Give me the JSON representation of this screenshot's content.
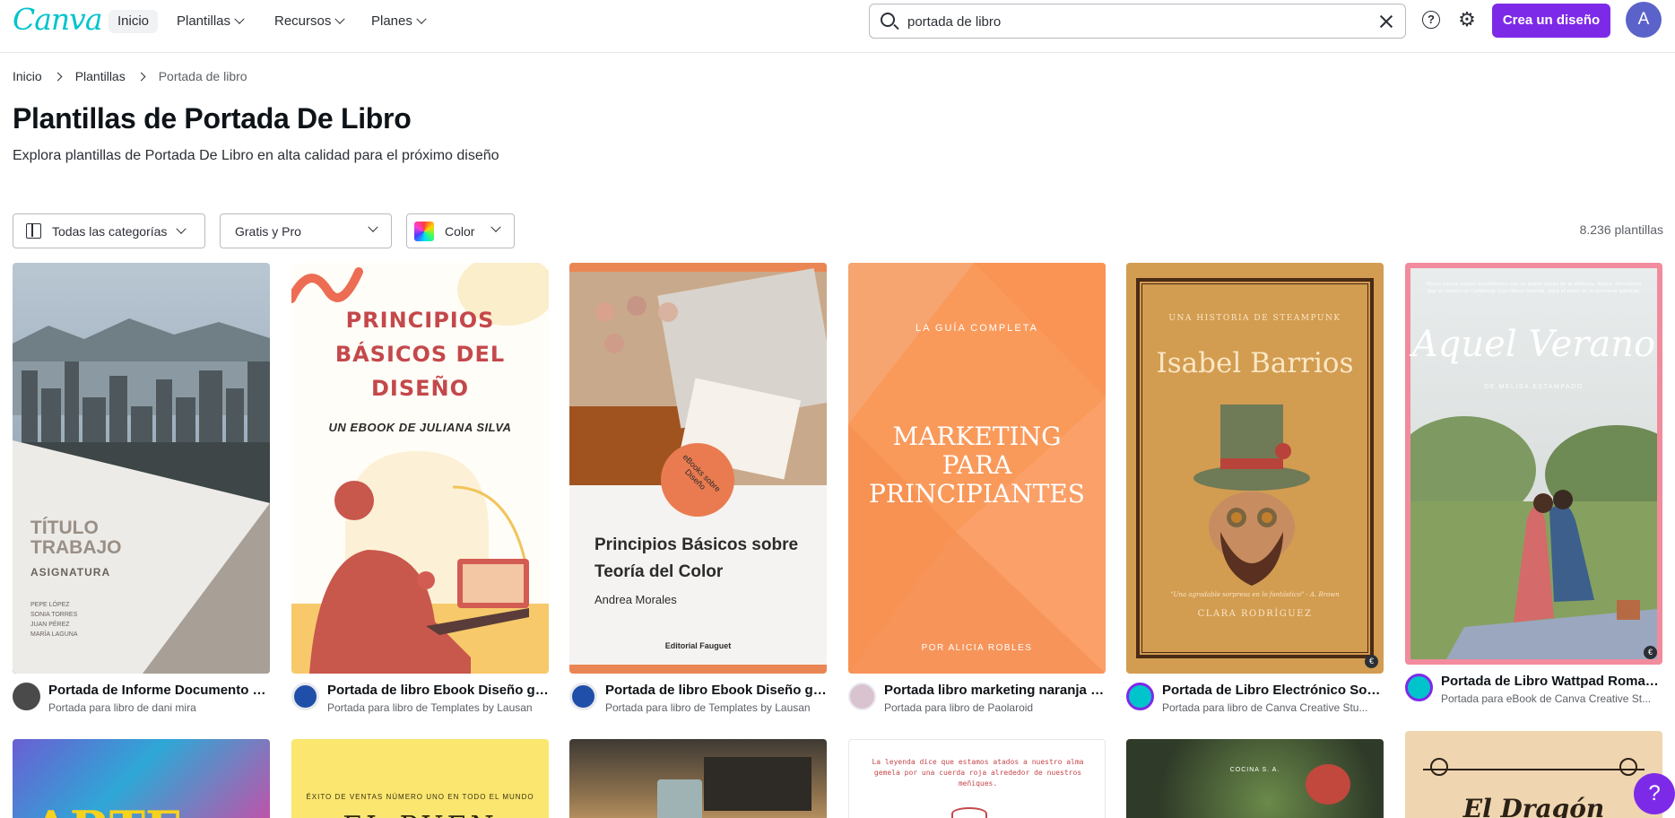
{
  "header": {
    "logo": "Canva",
    "nav": [
      {
        "label": "Inicio"
      },
      {
        "label": "Plantillas"
      },
      {
        "label": "Recursos"
      },
      {
        "label": "Planes"
      }
    ],
    "search_value": "portada de libro",
    "help_icon_glyph": "?",
    "create_label": "Crea un diseño",
    "avatar_letter": "A"
  },
  "breadcrumb": [
    "Inicio",
    "Plantillas",
    "Portada de libro"
  ],
  "title": "Plantillas de Portada De Libro",
  "subtitle": "Explora plantillas de Portada De Libro en alta calidad para el próximo diseño",
  "filters": {
    "category": "Todas las categorías",
    "price": "Gratis y Pro",
    "color": "Color"
  },
  "count": "8.236 plantillas",
  "cards": [
    {
      "title": "Portada de Informe Documento Pr...",
      "subtitle": "Portada para libro de dani mira",
      "cover": {
        "heading1": "TÍTULO",
        "heading2": "TRABAJO",
        "heading3": "ASIGNATURA",
        "names": [
          "PEPE LÓPEZ",
          "SONIA TORRES",
          "JUAN PÉREZ",
          "MARÍA LAGUNA"
        ]
      }
    },
    {
      "title": "Portada de libro Ebook Diseño grá...",
      "subtitle": "Portada para libro de Templates by Lausan",
      "cover": {
        "line1": "PRINCIPIOS",
        "line2": "BÁSICOS DEL",
        "line3": "DISEÑO",
        "sub": "UN EBOOK DE JULIANA SILVA"
      }
    },
    {
      "title": "Portada de libro Ebook Diseño grá...",
      "subtitle": "Portada para libro de Templates by Lausan",
      "cover": {
        "badge": "eBooks sobre Diseño",
        "title1": "Principios Básicos sobre",
        "title2": "Teoría del Color",
        "author": "Andrea Morales",
        "publisher": "Editorial Fauguet"
      }
    },
    {
      "title": "Portada libro marketing naranja bl...",
      "subtitle": "Portada para libro de Paolaroid",
      "cover": {
        "top": "LA GUÍA COMPLETA",
        "l1": "MARKETING",
        "l2": "PARA",
        "l3": "PRINCIPIANTES",
        "bottom": "POR ALICIA ROBLES"
      }
    },
    {
      "title": "Portada de Libro Electrónico Som...",
      "subtitle": "Portada para libro de Canva Creative Stu...",
      "cover": {
        "top": "UNA HISTORIA DE STEAMPUNK",
        "name": "Isabel Barrios",
        "quote": "\"Una agradable sorpresa en lo fantástico\"  - A. Brown",
        "author": "CLARA RODRÍGUEZ"
      }
    },
    {
      "title": "Portada de Libro Wattpad Romanc...",
      "subtitle": "Portada para eBook de Canva Creative St...",
      "cover": {
        "blurb": "María nunca esperó encontrarse con su mejor amigo de la infancia. Ahora, descubren que el verano en California. Los chicos traerán, para el resto de su preciosa amistad.",
        "title": "Aquel Verano",
        "author": "DE MELISA ESTAMPADO"
      }
    }
  ],
  "row2": [
    {
      "text": "ARTE"
    },
    {
      "top": "ÉXITO DE VENTAS NÚMERO UNO EN TODO EL MUNDO",
      "text": "EL PUEN"
    },
    {
      "text": ""
    },
    {
      "text": "La leyenda dice que estamos atados a nuestro alma gemela por una cuerda roja alrededor de nuestros meñiques."
    },
    {
      "text": "COCINA S. A."
    },
    {
      "text": "El Dragón"
    }
  ],
  "help_fab": "?",
  "colors": {
    "accent": "#7d2ae8",
    "canva": "#00c4cc"
  }
}
